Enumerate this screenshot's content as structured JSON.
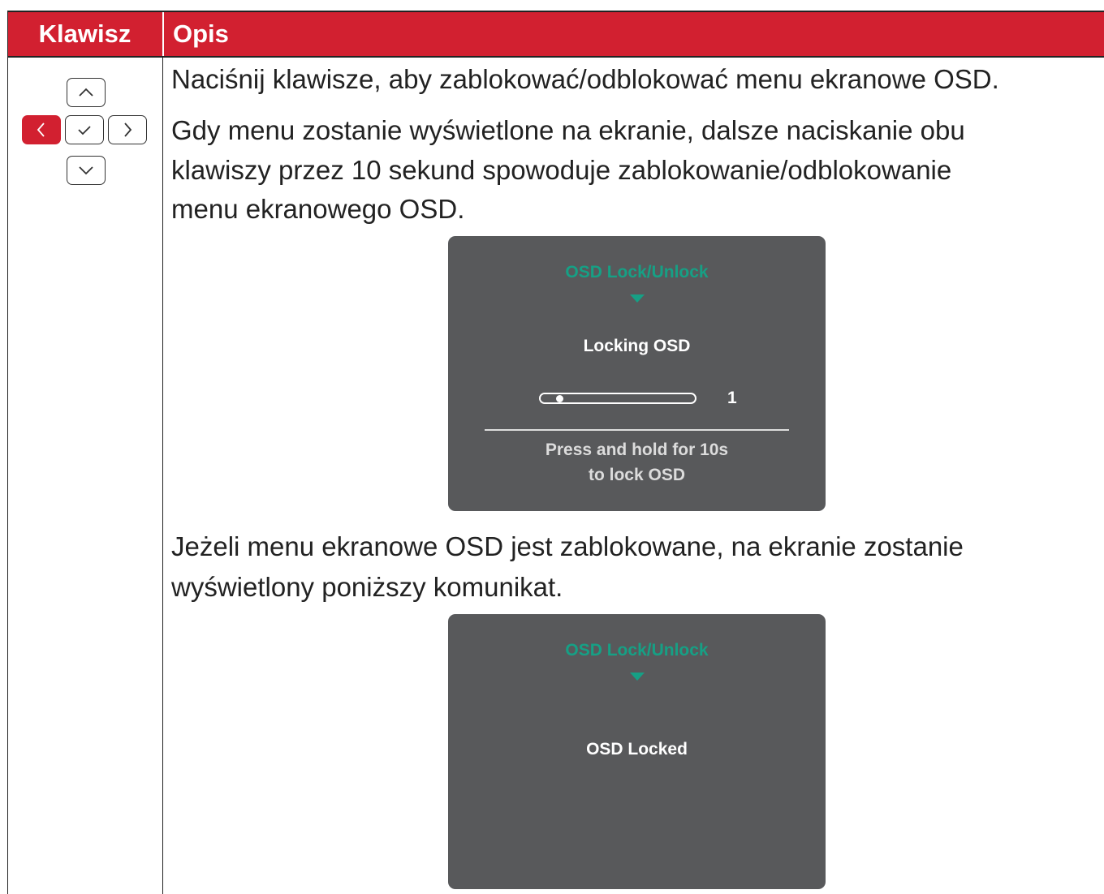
{
  "header": {
    "col_key": "Klawisz",
    "col_desc": "Opis"
  },
  "keys": [
    {
      "name": "up",
      "icon": "chevron-up-icon",
      "active": false
    },
    {
      "name": "left",
      "icon": "chevron-left-icon",
      "active": true
    },
    {
      "name": "ok",
      "icon": "check-icon",
      "active": false
    },
    {
      "name": "right",
      "icon": "chevron-right-icon",
      "active": false
    },
    {
      "name": "down",
      "icon": "chevron-down-icon",
      "active": false
    }
  ],
  "description": {
    "p1": "Naciśnij klawisze, aby zablokować/odblokować menu ekranowe OSD.",
    "p2_line1": "Gdy menu zostanie wyświetlone na ekranie, dalsze naciskanie obu",
    "p2_line2": "klawiszy przez 10 sekund spowoduje zablokowanie/odblokowanie",
    "p2_line3": "menu ekranowego OSD.",
    "p3_line1": "Jeżeli menu ekranowe OSD jest zablokowane, na ekranie zostanie",
    "p3_line2": "wyświetlony poniższy komunikat."
  },
  "osd1": {
    "title": "OSD Lock/Unlock",
    "label": "Locking OSD",
    "progress": 1,
    "progress_max": 10,
    "value_text": "1",
    "hint_line1": "Press and hold for 10s",
    "hint_line2": "to lock OSD"
  },
  "osd2": {
    "title": "OSD Lock/Unlock",
    "label": "OSD Locked"
  },
  "colors": {
    "accent": "#d22030",
    "osd_bg": "#58595b",
    "osd_title": "#16a085",
    "text": "#222222"
  }
}
